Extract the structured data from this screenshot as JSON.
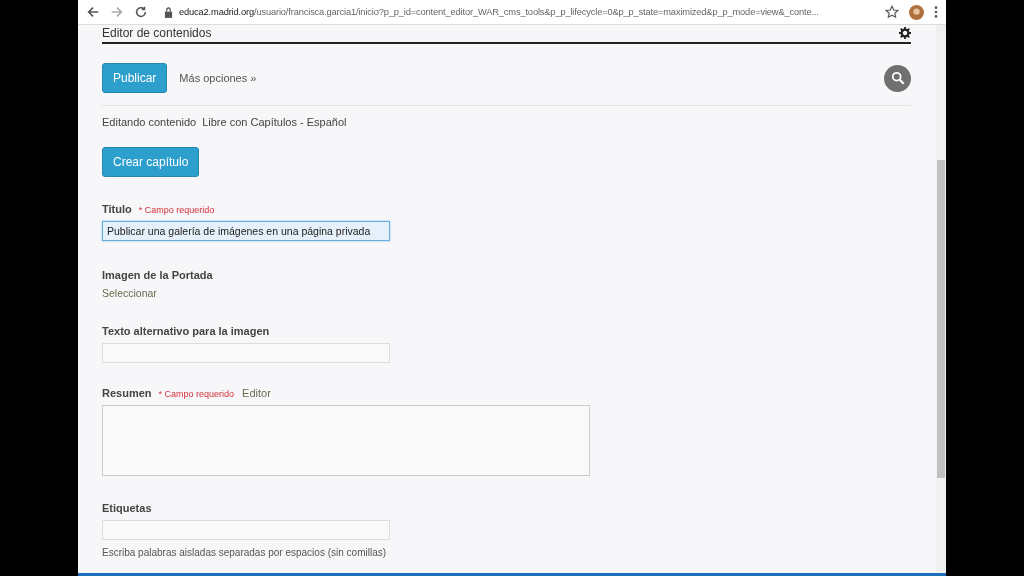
{
  "browser": {
    "url_host": "educa2.madrid.org",
    "url_path": "/usuario/francisca.garcia1/inicio?p_p_id=content_editor_WAR_cms_tools&p_p_lifecycle=0&p_p_state=maximized&p_p_mode=view&_conte..."
  },
  "portlet": {
    "title": "Editor de contenidos"
  },
  "toolbar": {
    "publish_button": "Publicar",
    "more_link": "Más opciones »"
  },
  "editing_info": {
    "label": "Editando contenido",
    "value": "Libre con Capítulos - Español"
  },
  "create_chapter_button": "Crear capítulo",
  "fields": [
    {
      "kind": "input",
      "label": "Titulo",
      "required_text": "* Campo requerido",
      "value": "Publicar una galería de imágenes en una página privada",
      "focused": true
    },
    {
      "kind": "image",
      "label": "Imagen de la Portada",
      "link": "Seleccionar"
    },
    {
      "kind": "input",
      "label": "Texto alternativo para la imagen",
      "focused": false
    },
    {
      "kind": "textarea",
      "label": "Resumen",
      "required_text": "* Campo requerido",
      "editor_link": "Editor"
    },
    {
      "kind": "input",
      "label": "Etiquetas",
      "focused": false,
      "hint": "Escriba palabras aisladas separadas por espacios (sin comillas)"
    }
  ]
}
